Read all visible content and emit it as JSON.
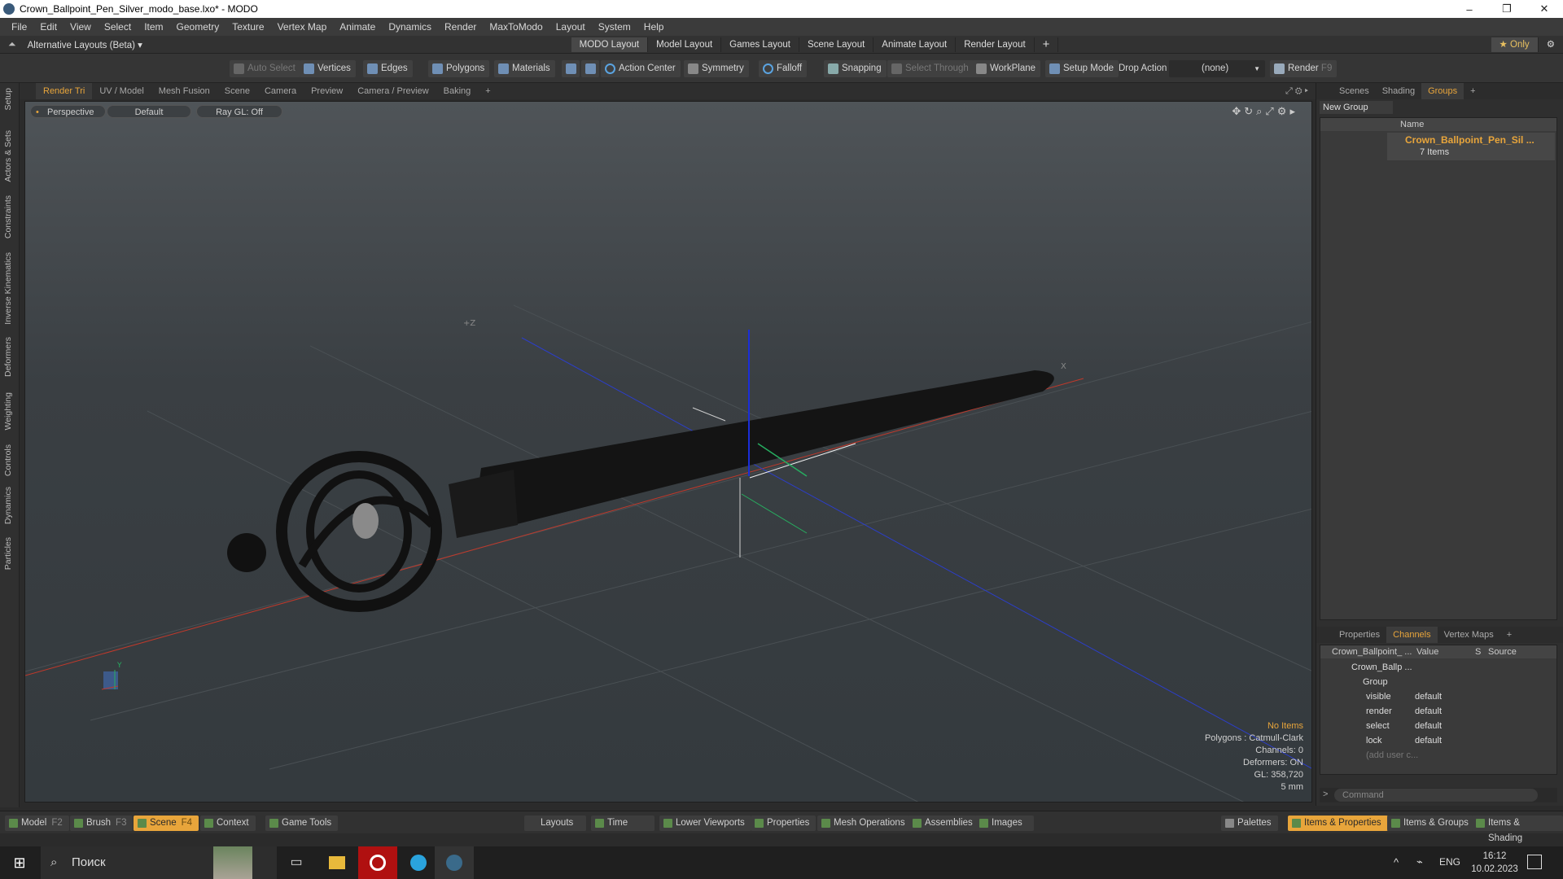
{
  "window": {
    "title": "Crown_Ballpoint_Pen_Silver_modo_base.lxo* - MODO",
    "minimize": "–",
    "maximize": "❐",
    "close": "✕"
  },
  "menu": [
    "File",
    "Edit",
    "View",
    "Select",
    "Item",
    "Geometry",
    "Texture",
    "Vertex Map",
    "Animate",
    "Dynamics",
    "Render",
    "MaxToModo",
    "Layout",
    "System",
    "Help"
  ],
  "layouts": {
    "selector": "Alternative Layouts (Beta) ▾",
    "tabs": [
      "MODO Layout",
      "Model Layout",
      "Games Layout",
      "Scene Layout",
      "Animate Layout",
      "Render Layout"
    ],
    "active": 0,
    "add": "+",
    "only": "★ Only"
  },
  "toolbar": {
    "auto_select": "Auto Select",
    "vertices": "Vertices",
    "edges": "Edges",
    "polygons": "Polygons",
    "materials": "Materials",
    "action_center": "Action Center",
    "symmetry": "Symmetry",
    "falloff": "Falloff",
    "snapping": "Snapping",
    "select_through": "Select Through",
    "workplane": "WorkPlane",
    "setup_mode": "Setup Mode",
    "drop_action": "Drop Action",
    "drop_value": "(none)",
    "render": "Render",
    "render_key": "F9"
  },
  "left_tabs": [
    "Setup",
    "Actors & Sets",
    "Constraints",
    "Inverse Kinematics",
    "Deformers",
    "Weighting",
    "Controls",
    "Dynamics",
    "Particles"
  ],
  "viewport_tabs": [
    "Render Tri",
    "UV / Model",
    "Mesh Fusion",
    "Scene",
    "Camera",
    "Preview",
    "Camera / Preview",
    "Baking",
    "+"
  ],
  "viewport": {
    "view": "Perspective",
    "shading": "Default",
    "raygl": "Ray GL: Off",
    "axis_label_z": "+Z",
    "axis_label_x": "X",
    "gizmo_y": "Y",
    "info": {
      "items": "No Items",
      "polygons": "Polygons : Catmull-Clark",
      "channels": "Channels: 0",
      "deformers": "Deformers: ON",
      "gl": "GL: 358,720",
      "scale": "5 mm"
    }
  },
  "groups_panel": {
    "tabs": [
      "Scenes",
      "Shading",
      "Groups",
      "+"
    ],
    "active": 2,
    "new_group": "New Group",
    "col_name": "Name",
    "item_name": "Crown_Ballpoint_Pen_Sil ...",
    "item_count": "7 Items"
  },
  "channels_panel": {
    "tabs": [
      "Properties",
      "Channels",
      "Vertex Maps",
      "+"
    ],
    "active": 1,
    "col_item": "Crown_Ballpoint_ ...",
    "col_value": "Value",
    "col_s": "S",
    "col_source": "Source",
    "root": "Crown_Ballp ...",
    "group": "Group",
    "rows": [
      {
        "name": "visible",
        "value": "default"
      },
      {
        "name": "render",
        "value": "default"
      },
      {
        "name": "select",
        "value": "default"
      },
      {
        "name": "lock",
        "value": "default"
      }
    ],
    "add_user": "(add user c...",
    "command": "Command",
    "prompt": ">"
  },
  "statusbar": {
    "model": "Model",
    "model_key": "F2",
    "brush": "Brush",
    "brush_key": "F3",
    "scene": "Scene",
    "scene_key": "F4",
    "context": "Context",
    "game_tools": "Game Tools",
    "layouts": "Layouts",
    "time": "Time",
    "lower_viewports": "Lower Viewports",
    "properties": "Properties",
    "mesh_operations": "Mesh Operations",
    "assemblies": "Assemblies",
    "images": "Images",
    "palettes": "Palettes",
    "items_properties": "Items & Properties",
    "items_groups": "Items & Groups",
    "items_shading": "Items & Shading"
  },
  "taskbar": {
    "search": "Поиск",
    "lang": "ENG",
    "time": "16:12",
    "date": "10.02.2023",
    "chevron": "^"
  },
  "colors": {
    "accent": "#e8a53b",
    "bg": "#2b2b2b",
    "viewport": "#3d4246",
    "axis_x": "#c0392b",
    "axis_y": "#27ae60",
    "axis_z": "#2c3ec9"
  }
}
